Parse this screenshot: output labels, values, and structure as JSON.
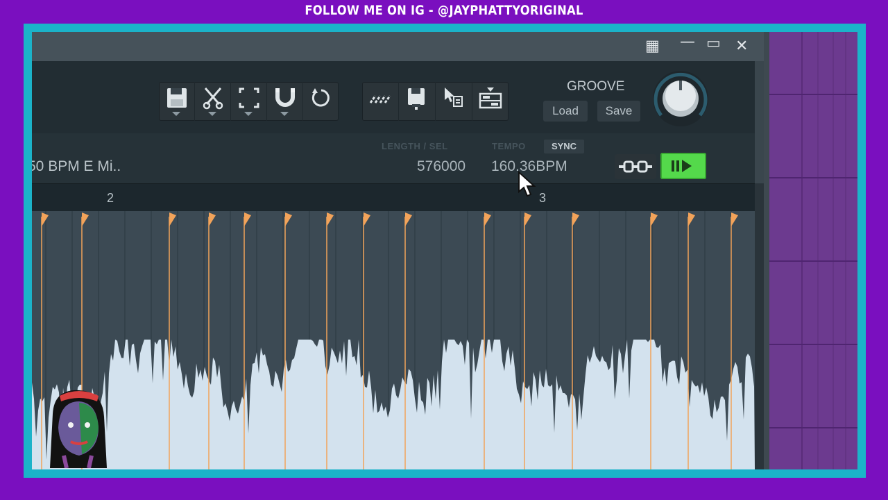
{
  "banner": {
    "text": "FOLLOW ME ON IG - @JAYPHATTYORIGINAL"
  },
  "window_controls": {
    "grid": "▦",
    "minimize": "—",
    "maximize": "▭",
    "close": "✕"
  },
  "toolbar": {
    "group1": [
      "save-icon",
      "cut-icon",
      "select-icon",
      "magnet-icon",
      "refresh-icon"
    ],
    "group2": [
      "beat-detect-icon",
      "save-marker-icon",
      "cursor-marker-icon",
      "slice-icon"
    ]
  },
  "groove": {
    "label": "GROOVE",
    "load": "Load",
    "save": "Save"
  },
  "info": {
    "length_label": "LENGTH / SEL",
    "tempo_label": "TEMPO",
    "sync_label": "SYNC",
    "sample_name": "50 BPM E Mi..",
    "length_value": "576000",
    "tempo_value": "160.36BPM"
  },
  "ruler": {
    "marks": [
      "2",
      "3"
    ]
  },
  "colors": {
    "frame": "#1bb3c9",
    "background": "#7a0fbf",
    "waveform": "#d3e2ee",
    "slice_marker": "#f2a35a",
    "play_button": "#54d94b"
  }
}
